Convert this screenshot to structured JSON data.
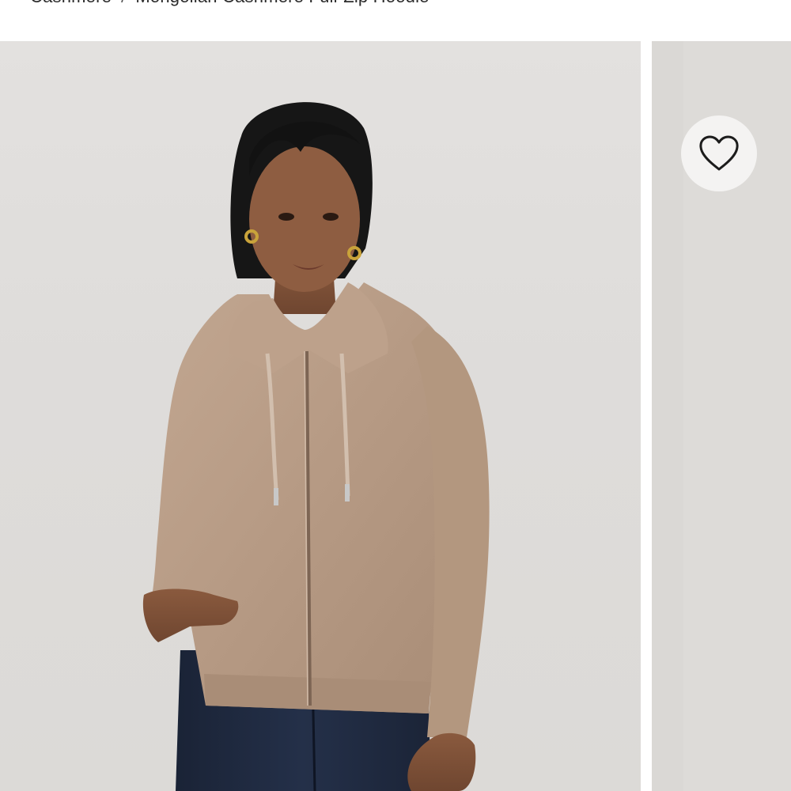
{
  "breadcrumb": {
    "items": [
      {
        "label": "Cashmere"
      },
      {
        "label": "Mongolian Cashmere Full-Zip Hoodie"
      }
    ],
    "separator": "/"
  },
  "gallery": {
    "main_image_icon": "product-photo-model-hoodie",
    "side_image_icon": "product-photo-secondary",
    "wishlist_icon": "heart-outline-icon"
  },
  "colors": {
    "background": "#dedcda",
    "sweater": "#b89c86",
    "jeans": "#1f2a3f",
    "wishlist_bg": "#f4f3f2"
  }
}
